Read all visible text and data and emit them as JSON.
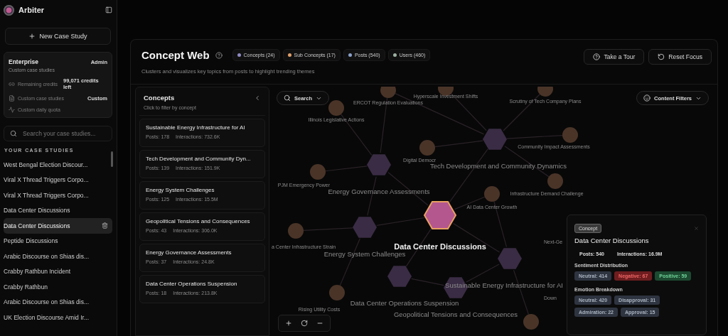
{
  "app": {
    "name": "Arbiter"
  },
  "sidebar": {
    "new_button": "New Case Study",
    "plan": {
      "name": "Enterprise",
      "role": "Admin",
      "description": "Custom case studies",
      "rows": [
        {
          "kind": "credits",
          "label": "Remaining credits",
          "value": "99,071 credits left"
        },
        {
          "kind": "document",
          "label": "Custom case studies",
          "value": "Custom"
        },
        {
          "kind": "pulse",
          "label": "Custom daily quota"
        }
      ]
    },
    "search": {
      "placeholder": "Search your case studies..."
    },
    "section_title": "YOUR CASE STUDIES",
    "items": [
      {
        "label": "West Bengal Election Discour...",
        "selected": false
      },
      {
        "label": "Viral X Thread Triggers Corpo...",
        "selected": false
      },
      {
        "label": "Viral X Thread Triggers Corpo...",
        "selected": false
      },
      {
        "label": "Data Center Discussions",
        "selected": false
      },
      {
        "label": "Data Center Discussions",
        "selected": true
      },
      {
        "label": "Peptide Discussions",
        "selected": false
      },
      {
        "label": "Arabic Discourse on Shias dis...",
        "selected": false
      },
      {
        "label": "Crabby Rathbun Incident",
        "selected": false
      },
      {
        "label": "Crabby Rathbun",
        "selected": false
      },
      {
        "label": "Arabic Discourse on Shias dis...",
        "selected": false
      },
      {
        "label": "UK Election Discourse Amid Ir...",
        "selected": false
      }
    ]
  },
  "header": {
    "title": "Concept Web",
    "subtitle": "Clusters and visualizes key topics from posts to highlight trending themes",
    "legend": [
      {
        "label": "Concepts (24)",
        "color": "#8f8bc4"
      },
      {
        "label": "Sub Concepts (17)",
        "color": "#e0a06a"
      },
      {
        "label": "Posts (540)",
        "color": "#8aa0c8"
      },
      {
        "label": "Users (460)",
        "color": "#9bb0a0"
      }
    ],
    "buttons": [
      {
        "kind": "tour",
        "label": "Take a Tour"
      },
      {
        "kind": "reset",
        "label": "Reset Focus"
      }
    ]
  },
  "concepts_panel": {
    "title": "Concepts",
    "subtitle": "Click to filter by concept",
    "items": [
      {
        "title": "Sustainable Energy Infrastructure for AI",
        "posts": "Posts: 178",
        "interactions": "Interactions: 732.6K"
      },
      {
        "title": "Tech Development and Community Dyn...",
        "posts": "Posts: 139",
        "interactions": "Interactions: 151.9K"
      },
      {
        "title": "Energy System Challenges",
        "posts": "Posts: 125",
        "interactions": "Interactions: 15.5M"
      },
      {
        "title": "Geopolitical Tensions and Consequences",
        "posts": "Posts: 43",
        "interactions": "Interactions: 306.0K"
      },
      {
        "title": "Energy Governance Assessments",
        "posts": "Posts: 37",
        "interactions": "Interactions: 24.8K"
      },
      {
        "title": "Data Center Operations Suspension",
        "posts": "Posts: 18",
        "interactions": "Interactions: 213.8K"
      }
    ]
  },
  "graph": {
    "search_label": "Search",
    "filter_label": "Content Filters",
    "nodes": [
      {
        "kind": "concept",
        "label": "Tech Development and Community Dynamics",
        "selected": false
      },
      {
        "kind": "concept",
        "label": "Energy Governance Assessments",
        "selected": false
      },
      {
        "kind": "concept",
        "label": "Energy System Challenges",
        "selected": false
      },
      {
        "kind": "concept",
        "label": "Data Center Discussions",
        "selected": true
      },
      {
        "kind": "concept",
        "label": "Sustainable Energy Infrastructure for AI",
        "selected": false
      },
      {
        "kind": "concept",
        "label": "Data Center Operations Suspension",
        "selected": false
      },
      {
        "kind": "concept",
        "label": "Geopolitical Tensions and Consequences",
        "selected": false
      },
      {
        "kind": "sub",
        "label": "ERCOT Regulation Evaluations",
        "selected": false
      },
      {
        "kind": "sub",
        "label": "Hyperscale Investment Shifts",
        "selected": false
      },
      {
        "kind": "sub",
        "label": "Scrutiny of Tech Company Plans",
        "selected": false
      },
      {
        "kind": "sub",
        "label": "Illinois Legislative Actions",
        "selected": false
      },
      {
        "kind": "sub",
        "label": "Digital Democr",
        "selected": false
      },
      {
        "kind": "sub",
        "label": "Community Impact Assessments",
        "selected": false
      },
      {
        "kind": "sub",
        "label": "PJM Emergency Power",
        "selected": false
      },
      {
        "kind": "sub",
        "label": "Infrastructure Demand Challenge",
        "selected": false
      },
      {
        "kind": "sub",
        "label": "AI Data Center Growth",
        "selected": false
      },
      {
        "kind": "sub",
        "label": "a Center Infrastructure Strain",
        "selected": false
      },
      {
        "kind": "sub",
        "label": "Rising Utility Costs",
        "selected": false
      },
      {
        "kind": "sub",
        "selected": false
      }
    ],
    "covered_labels": [
      "Next-Ge",
      "Down"
    ]
  },
  "details": {
    "badge": "Concept",
    "title": "Data Center Discussions",
    "posts": "Posts: 540",
    "interactions": "Interactions: 16.9M",
    "sentiment_title": "Sentiment Distribution",
    "sentiment": [
      {
        "kind": "neutral",
        "label": "Neutral: 414"
      },
      {
        "kind": "negative",
        "label": "Negative: 67"
      },
      {
        "kind": "positive",
        "label": "Positive: 59"
      }
    ],
    "emotion_title": "Emotion Breakdown",
    "emotions": [
      {
        "kind": "neutral",
        "label": "Neutral: 420"
      },
      {
        "kind": "neutral",
        "label": "Disapproval: 31"
      },
      {
        "kind": "neutral",
        "label": "Admiration: 22"
      },
      {
        "kind": "neutral",
        "label": "Approval: 15"
      }
    ]
  }
}
